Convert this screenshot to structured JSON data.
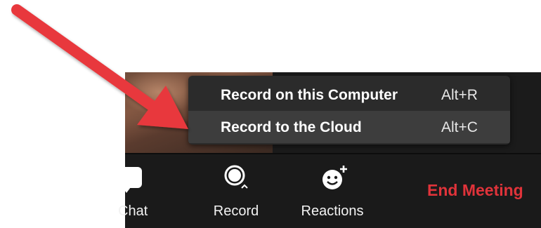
{
  "menu": {
    "items": [
      {
        "label": "Record on this Computer",
        "shortcut": "Alt+R"
      },
      {
        "label": "Record to the Cloud",
        "shortcut": "Alt+C"
      }
    ]
  },
  "toolbar": {
    "chat_label": "Chat",
    "record_label": "Record",
    "reactions_label": "Reactions",
    "end_meeting_label": "End Meeting"
  },
  "icons": {
    "chat": "chat-bubble-icon",
    "record": "record-icon",
    "reactions": "smiley-plus-icon",
    "annotation": "red-arrow"
  },
  "colors": {
    "toolbar_bg": "#1a1a1a",
    "menu_bg": "#2b2b2b",
    "menu_highlight": "#3d3d3d",
    "end_meeting": "#e0333a",
    "arrow": "#e8383d"
  }
}
